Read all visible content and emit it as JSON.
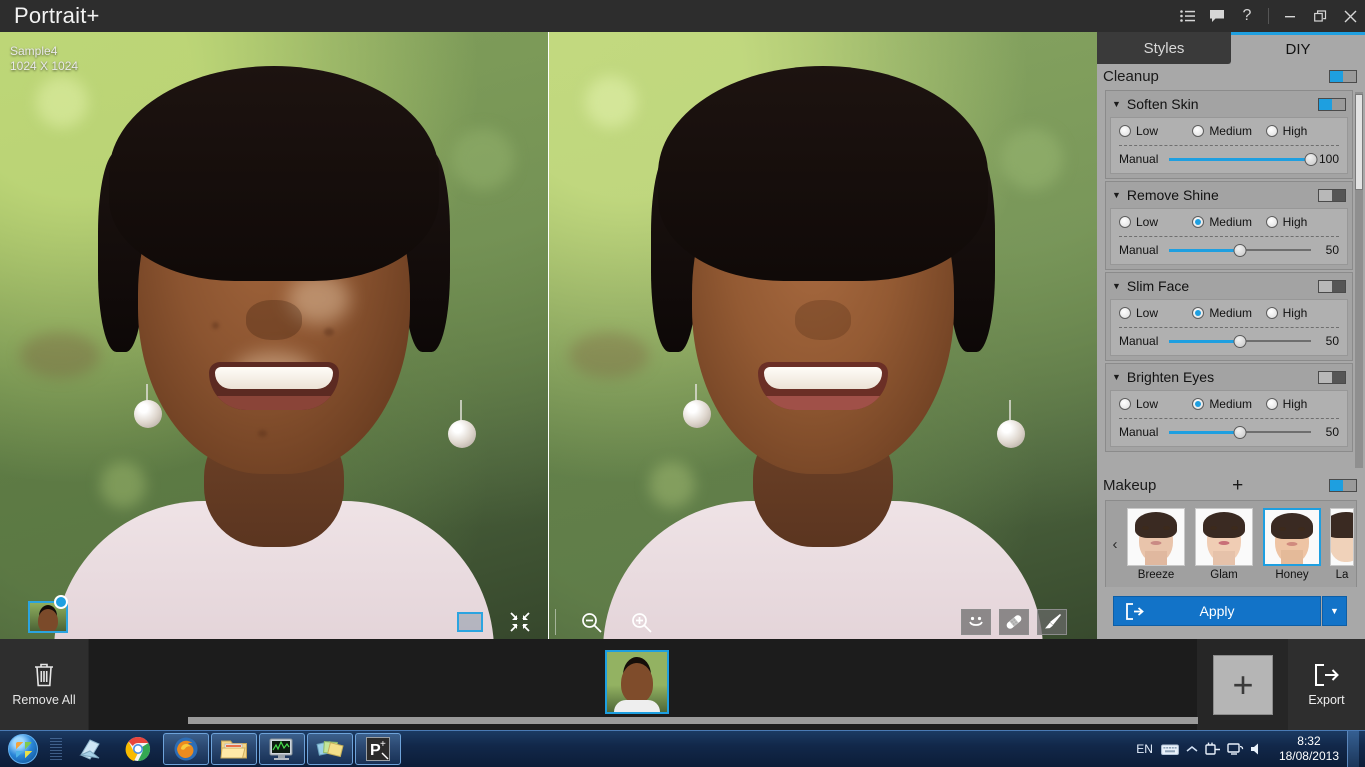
{
  "window": {
    "title": "Portrait+",
    "controls": [
      {
        "name": "list-icon",
        "glyph": "list"
      },
      {
        "name": "feedback-icon",
        "glyph": "comment"
      },
      {
        "name": "help-icon",
        "glyph": "?"
      },
      {
        "name": "minimize-icon",
        "glyph": "minimize"
      },
      {
        "name": "restore-icon",
        "glyph": "restore"
      },
      {
        "name": "close-icon",
        "glyph": "close"
      }
    ]
  },
  "viewer": {
    "image_name": "Sample4",
    "image_size": "1024 X 1024",
    "tools_center": [
      {
        "name": "split-view-icon",
        "label": "split-view"
      },
      {
        "name": "fit-screen-icon",
        "label": "fit-screen"
      },
      {
        "name": "zoom-out-icon",
        "label": "zoom-out"
      },
      {
        "name": "zoom-in-icon",
        "label": "zoom-in"
      }
    ],
    "tools_right": [
      {
        "name": "face-detect-icon",
        "label": "face-detect"
      },
      {
        "name": "blemish-remover-icon",
        "label": "blemish-remover"
      },
      {
        "name": "brush-icon",
        "label": "brush"
      }
    ]
  },
  "panel": {
    "tabs": [
      {
        "label": "Styles",
        "active": false
      },
      {
        "label": "DIY",
        "active": true
      }
    ],
    "cleanup": {
      "title": "Cleanup",
      "enabled": true,
      "sections": [
        {
          "title": "Soften Skin",
          "enabled": true,
          "levels": [
            "Low",
            "Medium",
            "High"
          ],
          "selected": null,
          "manual_label": "Manual",
          "manual_value": 100
        },
        {
          "title": "Remove Shine",
          "enabled": false,
          "levels": [
            "Low",
            "Medium",
            "High"
          ],
          "selected": "Medium",
          "manual_label": "Manual",
          "manual_value": 50
        },
        {
          "title": "Slim Face",
          "enabled": false,
          "levels": [
            "Low",
            "Medium",
            "High"
          ],
          "selected": "Medium",
          "manual_label": "Manual",
          "manual_value": 50
        },
        {
          "title": "Brighten Eyes",
          "enabled": false,
          "levels": [
            "Low",
            "Medium",
            "High"
          ],
          "selected": "Medium",
          "manual_label": "Manual",
          "manual_value": 50
        }
      ]
    },
    "makeup": {
      "title": "Makeup",
      "enabled": true,
      "add_label": "+",
      "prev_arrow": "‹",
      "next_arrow": "›",
      "presets": [
        {
          "label": "Breeze",
          "selected": false,
          "skin": "#e9c4ab",
          "lip": "#c98a84"
        },
        {
          "label": "Glam",
          "selected": false,
          "skin": "#f0cdb4",
          "lip": "#c96f78"
        },
        {
          "label": "Honey",
          "selected": true,
          "skin": "#eec4a4",
          "lip": "#d08a7e"
        },
        {
          "label": "La",
          "selected": false,
          "skin": "#f0d2ba",
          "lip": "#cc8b86"
        }
      ]
    },
    "apply": {
      "label": "Apply",
      "dropdown_glyph": "▼"
    }
  },
  "filmstrip": {
    "remove_all_label": "Remove All",
    "add_label": "+",
    "export_label": "Export",
    "thumbnails": [
      {
        "name": "sample4-thumbnail",
        "selected": true
      }
    ]
  },
  "taskbar": {
    "apps": [
      {
        "name": "taskbar-notepad",
        "pinned": false
      },
      {
        "name": "taskbar-chrome",
        "pinned": false
      },
      {
        "name": "taskbar-firefox",
        "pinned": true
      },
      {
        "name": "taskbar-explorer",
        "pinned": true
      },
      {
        "name": "taskbar-task-manager",
        "pinned": true
      },
      {
        "name": "taskbar-photos",
        "pinned": true
      },
      {
        "name": "taskbar-portrait-plus",
        "pinned": true
      }
    ],
    "language": "EN",
    "tray": [
      "keyboard-icon",
      "show-hidden-icon",
      "power-icon",
      "network-icon",
      "volume-icon"
    ],
    "time": "8:32",
    "date": "18/08/2013"
  },
  "colors": {
    "accent": "#1e9fe0",
    "apply_blue": "#1273c8",
    "panel_gray": "#a8a8a8",
    "titlebar": "#2d2d2d"
  }
}
